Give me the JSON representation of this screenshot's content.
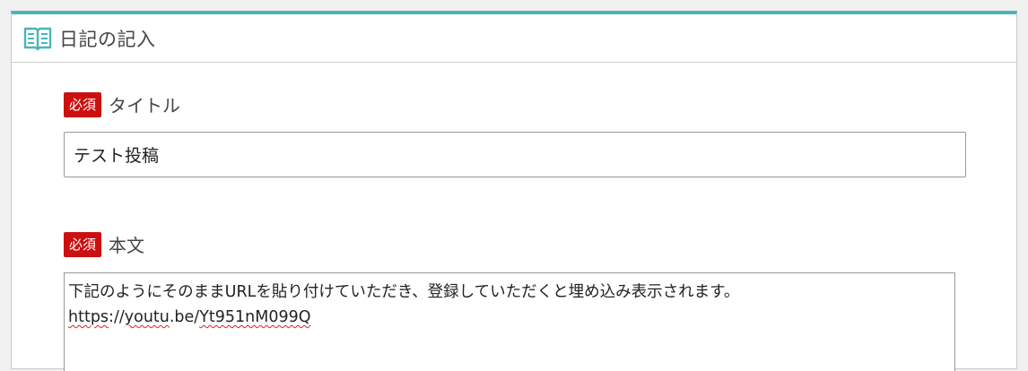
{
  "header": {
    "title": "日記の記入",
    "icon": "book-icon",
    "accent_color": "#4ab5b9"
  },
  "fields": {
    "title": {
      "badge": "必須",
      "label": "タイトル",
      "value": "テスト投稿"
    },
    "body": {
      "badge": "必須",
      "label": "本文",
      "line1": "下記のようにそのままURLを貼り付けていただき、登録していただくと埋め込み表示されます。",
      "url_parts": [
        "https",
        "://",
        "youtu",
        ".be/",
        "Yt951nM099Q"
      ]
    }
  },
  "badge_color": "#cc1010"
}
